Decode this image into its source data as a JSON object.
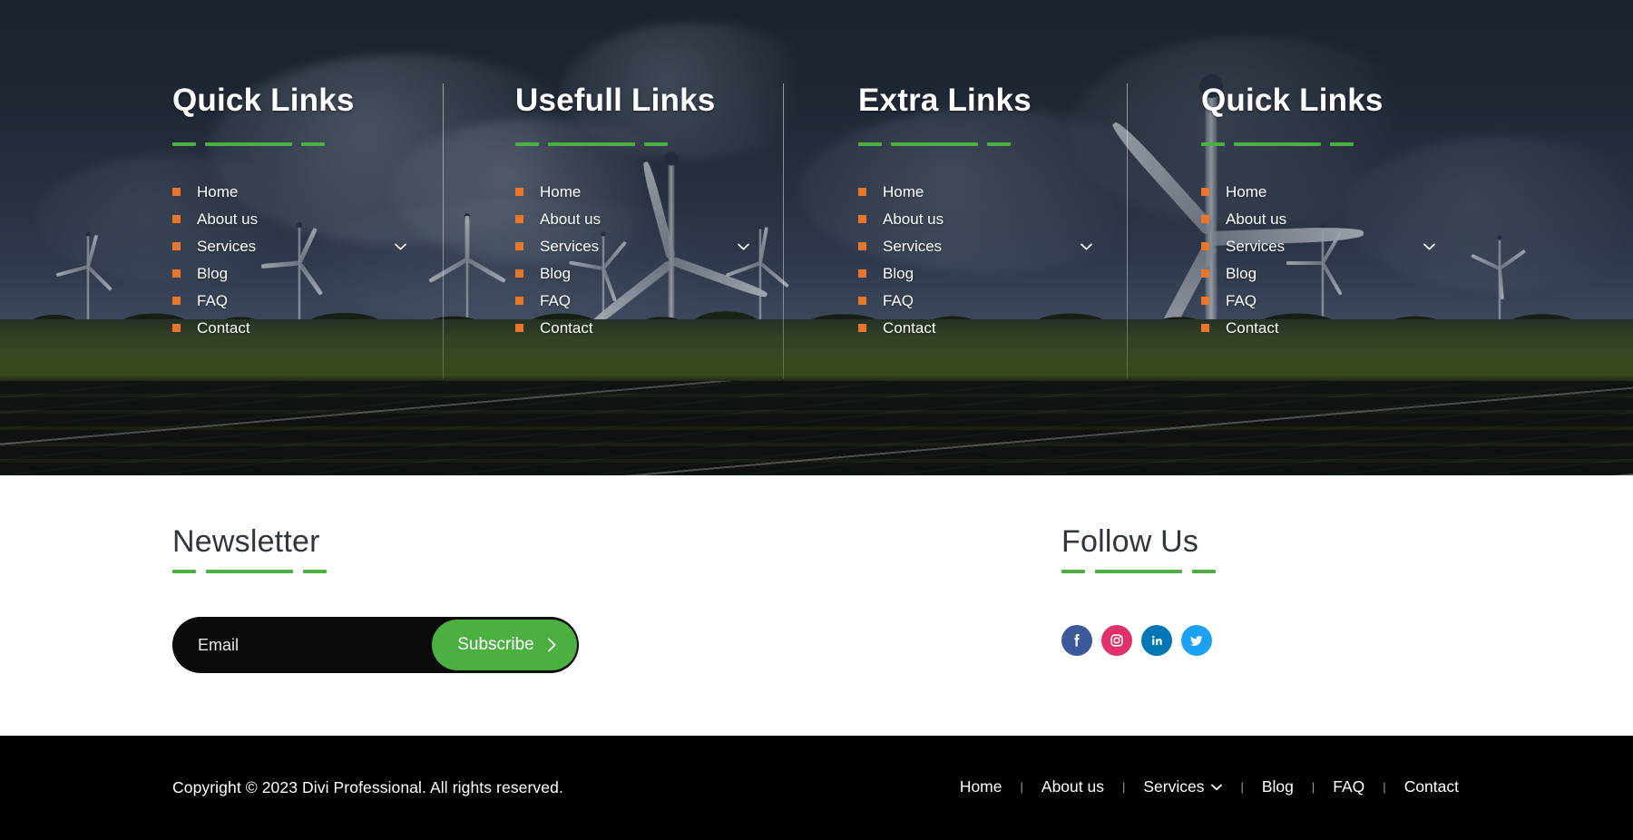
{
  "colors": {
    "accent_green": "#4CAF42",
    "bullet_orange": "#E8762B",
    "dark_bar": "#000000",
    "heading_dark": "#30363D",
    "facebook": "#3B5998",
    "instagram": "#E1306C",
    "linkedin": "#0077B5",
    "twitter": "#1DA1F2"
  },
  "footer_columns": [
    {
      "title": "Quick Links",
      "links": [
        {
          "label": "Home",
          "has_submenu": false
        },
        {
          "label": "About us",
          "has_submenu": false
        },
        {
          "label": "Services",
          "has_submenu": true
        },
        {
          "label": "Blog",
          "has_submenu": false
        },
        {
          "label": "FAQ",
          "has_submenu": false
        },
        {
          "label": "Contact",
          "has_submenu": false
        }
      ]
    },
    {
      "title": "Usefull Links",
      "links": [
        {
          "label": "Home",
          "has_submenu": false
        },
        {
          "label": "About us",
          "has_submenu": false
        },
        {
          "label": "Services",
          "has_submenu": true
        },
        {
          "label": "Blog",
          "has_submenu": false
        },
        {
          "label": "FAQ",
          "has_submenu": false
        },
        {
          "label": "Contact",
          "has_submenu": false
        }
      ]
    },
    {
      "title": "Extra Links",
      "links": [
        {
          "label": "Home",
          "has_submenu": false
        },
        {
          "label": "About us",
          "has_submenu": false
        },
        {
          "label": "Services",
          "has_submenu": true
        },
        {
          "label": "Blog",
          "has_submenu": false
        },
        {
          "label": "FAQ",
          "has_submenu": false
        },
        {
          "label": "Contact",
          "has_submenu": false
        }
      ]
    },
    {
      "title": "Quick Links",
      "links": [
        {
          "label": "Home",
          "has_submenu": false
        },
        {
          "label": "About us",
          "has_submenu": false
        },
        {
          "label": "Services",
          "has_submenu": true
        },
        {
          "label": "Blog",
          "has_submenu": false
        },
        {
          "label": "FAQ",
          "has_submenu": false
        },
        {
          "label": "Contact",
          "has_submenu": false
        }
      ]
    }
  ],
  "newsletter": {
    "title": "Newsletter",
    "email_placeholder": "Email",
    "email_value": "",
    "submit_label": "Subscribe",
    "submit_icon": "chevron-right-icon"
  },
  "follow": {
    "title": "Follow Us",
    "socials": [
      {
        "name": "facebook",
        "icon": "facebook-icon",
        "color": "#3B5998"
      },
      {
        "name": "instagram",
        "icon": "instagram-icon",
        "color": "#E1306C"
      },
      {
        "name": "linkedin",
        "icon": "linkedin-icon",
        "color": "#0077B5"
      },
      {
        "name": "twitter",
        "icon": "twitter-icon",
        "color": "#1DA1F2"
      }
    ]
  },
  "bottom_bar": {
    "copyright": "Copyright © 2023 Divi Professional. All rights reserved.",
    "separator": "|",
    "nav": [
      {
        "label": "Home",
        "has_submenu": false
      },
      {
        "label": "About us",
        "has_submenu": false
      },
      {
        "label": "Services",
        "has_submenu": true
      },
      {
        "label": "Blog",
        "has_submenu": false
      },
      {
        "label": "FAQ",
        "has_submenu": false
      },
      {
        "label": "Contact",
        "has_submenu": false
      }
    ]
  }
}
